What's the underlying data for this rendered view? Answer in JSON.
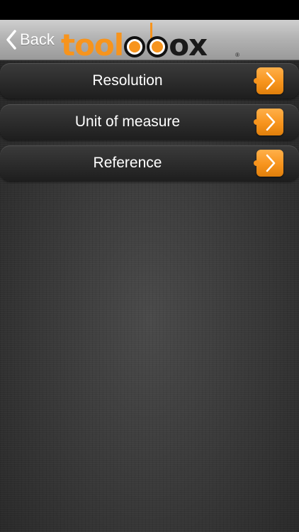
{
  "nav": {
    "back_label": "Back",
    "logo_part1": "tool",
    "logo_part2": "ox",
    "logo_reg": "®"
  },
  "menu": {
    "items": [
      {
        "label": "Resolution"
      },
      {
        "label": "Unit of measure"
      },
      {
        "label": "Reference"
      }
    ]
  },
  "colors": {
    "accent": "#f7941d",
    "nav_bar": "#b3b3b3",
    "row_background": "#2a2a2a"
  }
}
